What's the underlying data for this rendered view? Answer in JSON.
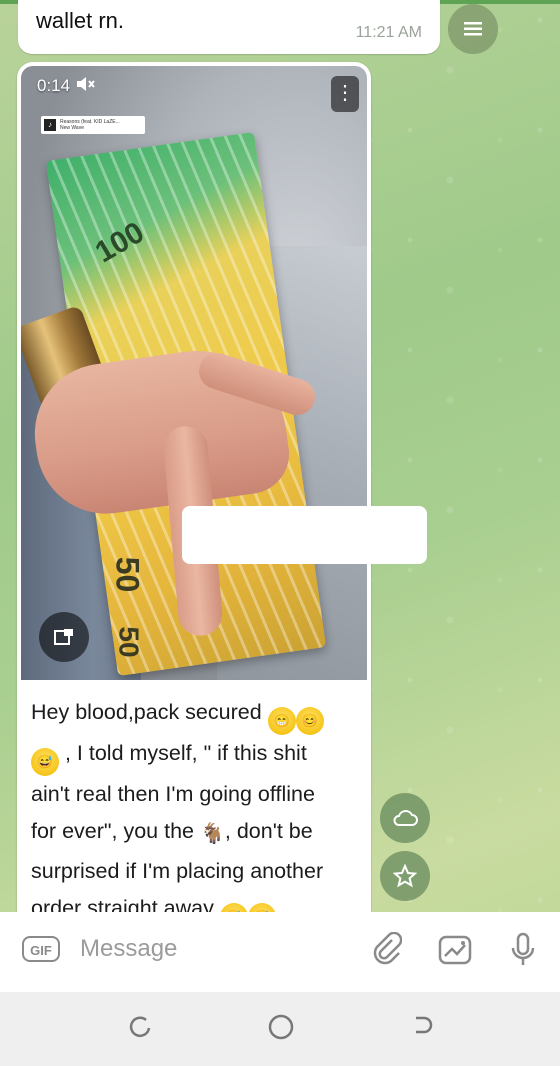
{
  "prev_message": {
    "text": "wallet rn.",
    "time": "11:21 AM"
  },
  "video": {
    "time": "0:14",
    "muted": true,
    "music_tag": {
      "title": "Reasons (feat. KID LaZE...",
      "artist": "New Wave"
    },
    "bill_numbers": [
      "100",
      "50",
      "50"
    ]
  },
  "caption": {
    "line1": "Hey blood,pack secured",
    "line2": ", I told myself, \" if this shit",
    "line3": "ain't real then I'm going offline",
    "line4a": "for ever\", you the",
    "line4b": ", don't be",
    "line5": "surprised if I'm placing another",
    "line6": "order straight away"
  },
  "input": {
    "gif_label": "GIF",
    "placeholder": "Message",
    "value": ""
  },
  "colors": {
    "accent": "#5fa355",
    "bubble": "#ffffff",
    "caret": "#3a8ee6"
  }
}
